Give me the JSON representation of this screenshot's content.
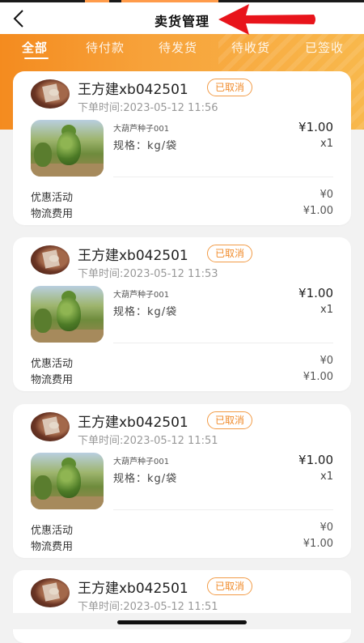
{
  "header": {
    "title": "卖货管理"
  },
  "tabs": [
    {
      "label": "全部",
      "active": true
    },
    {
      "label": "待付款",
      "active": false
    },
    {
      "label": "待发货",
      "active": false
    },
    {
      "label": "待收货",
      "active": false
    },
    {
      "label": "已签收",
      "active": false
    }
  ],
  "orders": [
    {
      "buyer": "王方建xb042501",
      "status": "已取消",
      "time": "下单时间:2023-05-12 11:56",
      "product": {
        "name": "大葫芦种子001",
        "spec": "规格：kg/袋",
        "price": "¥1.00",
        "qty": "x1"
      },
      "discount": {
        "label": "优惠活动",
        "value": "¥0"
      },
      "shipping": {
        "label": "物流费用",
        "value": "¥1.00"
      }
    },
    {
      "buyer": "王方建xb042501",
      "status": "已取消",
      "time": "下单时间:2023-05-12 11:53",
      "product": {
        "name": "大葫芦种子001",
        "spec": "规格：kg/袋",
        "price": "¥1.00",
        "qty": "x1"
      },
      "discount": {
        "label": "优惠活动",
        "value": "¥0"
      },
      "shipping": {
        "label": "物流费用",
        "value": "¥1.00"
      }
    },
    {
      "buyer": "王方建xb042501",
      "status": "已取消",
      "time": "下单时间:2023-05-12 11:51",
      "product": {
        "name": "大葫芦种子001",
        "spec": "规格：kg/袋",
        "price": "¥1.00",
        "qty": "x1"
      },
      "discount": {
        "label": "优惠活动",
        "value": "¥0"
      },
      "shipping": {
        "label": "物流费用",
        "value": "¥1.00"
      }
    },
    {
      "buyer": "王方建xb042501",
      "status": "已取消",
      "time": "下单时间:2023-05-12 11:51"
    }
  ],
  "colors": {
    "accent": "#f48b1f",
    "status_border": "#f29b46",
    "annotation_arrow": "#e8141b"
  },
  "icons": {
    "back": "chevron-left-icon",
    "annotation": "red-arrow-icon"
  }
}
